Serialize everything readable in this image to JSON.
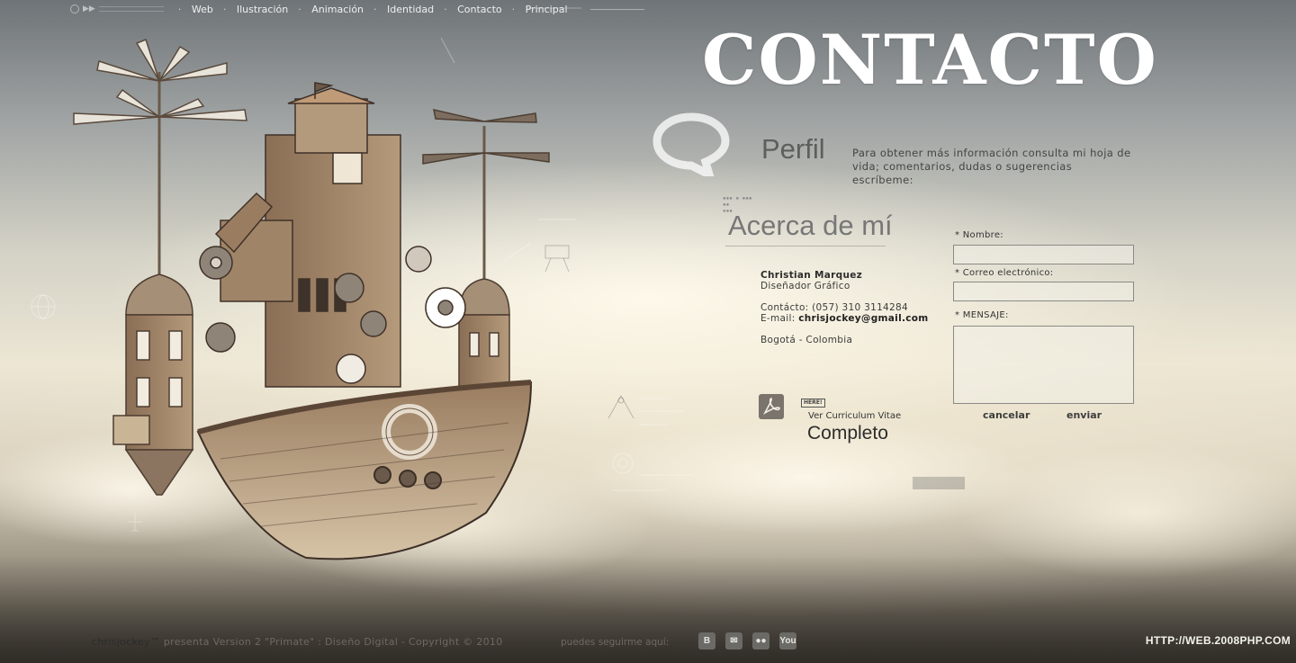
{
  "nav": {
    "items": [
      {
        "label": "Web"
      },
      {
        "label": "Ilustración"
      },
      {
        "label": "Animación"
      },
      {
        "label": "Identidad"
      },
      {
        "label": "Contacto"
      },
      {
        "label": "Principal"
      }
    ]
  },
  "header": {
    "title": "CONTACTO"
  },
  "profile_section": {
    "heading": "Perfil",
    "intro": "Para obtener más información consulta mi hoja de vida; comentarios, dudas o sugerencias escríbeme:"
  },
  "about": {
    "heading": "Acerca de mí",
    "name": "Christian Marquez",
    "role": "Diseñador Gráfico",
    "phone_label": "Contácto:",
    "phone": "(057) 310 3114284",
    "email_label": "E-mail:",
    "email": "chrisjockey@gmail.com",
    "location": "Bogotá - Colombia"
  },
  "cv": {
    "tag": "HERE!",
    "label": "Ver Curriculum Vitae",
    "big": "Completo"
  },
  "form": {
    "name_label": "* Nombre:",
    "name_value": "",
    "email_label": "* Correo electrónico:",
    "email_value": "",
    "message_label": "* MENSAJE:",
    "message_value": "",
    "cancel_label": "cancelar",
    "send_label": "enviar"
  },
  "footer": {
    "brand": "chrisjockey™",
    "presents": "presenta",
    "version_text": "Version 2 \"Primate\"",
    "rest": ": Diseño Digital - Copyright © 2010",
    "mid": "puedes seguirme aquí:",
    "socials": [
      {
        "icon": "blogger-icon",
        "glyph": "B"
      },
      {
        "icon": "mail-icon",
        "glyph": "✉"
      },
      {
        "icon": "flickr-icon",
        "glyph": "●●"
      },
      {
        "icon": "youtube-icon",
        "glyph": "You"
      }
    ],
    "watermark": "HTTP://WEB.2008PHP.COM"
  },
  "colors": {
    "title": "#ffffff",
    "text": "#333333",
    "sky_top": "#6f7478",
    "sky_mid": "#ece6d4"
  }
}
